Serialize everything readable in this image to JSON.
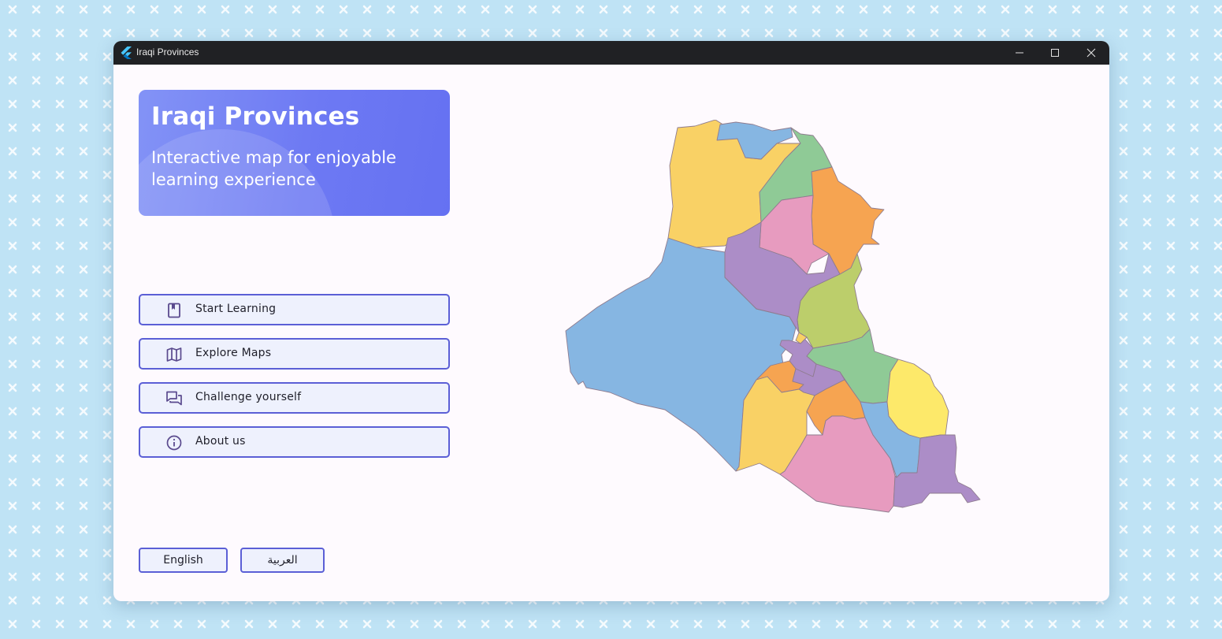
{
  "window": {
    "title": "Iraqi Provinces"
  },
  "hero": {
    "title": "Iraqi Provinces",
    "subtitle": "Interactive map for enjoyable learning experience"
  },
  "menu": {
    "items": [
      {
        "label": "Start Learning",
        "icon": "bookmark-book-icon"
      },
      {
        "label": "Explore Maps",
        "icon": "map-icon"
      },
      {
        "label": "Challenge yourself",
        "icon": "chat-bubbles-icon"
      },
      {
        "label": "About us",
        "icon": "info-icon"
      }
    ]
  },
  "language": {
    "english": "English",
    "arabic": "العربية"
  },
  "colors": {
    "accent": "#5b5fd6",
    "hero_gradient_start": "#8393f6",
    "hero_gradient_end": "#6571f2",
    "button_bg": "#eef1fd",
    "map_blue": "#86b6e2",
    "map_yellow": "#f9d165",
    "map_green": "#8fca96",
    "map_orange": "#f6a451",
    "map_pink": "#e79bbf",
    "map_purple": "#ac8dc7",
    "map_lime": "#bcce6b",
    "map_bright_yellow": "#fde96a"
  }
}
